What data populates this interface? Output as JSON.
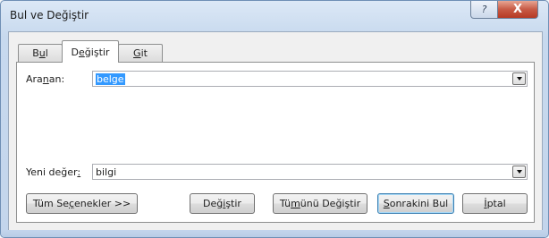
{
  "window": {
    "title": "Bul ve Değiştir"
  },
  "titlebar": {
    "help_label": "?",
    "close_label": "X"
  },
  "tabs": [
    {
      "pre": "B",
      "key": "u",
      "post": "l"
    },
    {
      "pre": "D",
      "key": "e",
      "post": "ğiştir"
    },
    {
      "pre": "",
      "key": "G",
      "post": "it"
    }
  ],
  "find": {
    "label_pre": "Ara",
    "label_key": "n",
    "label_post": "an:",
    "value": "belge"
  },
  "replace": {
    "label_pre": "Yeni değer",
    "label_key": ":",
    "label_post": "",
    "value": "bilgi"
  },
  "buttons": {
    "more": {
      "pre": "Tüm Se",
      "key": "ç",
      "post": "enekler >>"
    },
    "replace": {
      "pre": "Değ",
      "key": "i",
      "post": "ştir"
    },
    "replace_all": {
      "pre": "Tü",
      "key": "m",
      "post": "ünü Değiştir"
    },
    "find_next": {
      "pre": "",
      "key": "S",
      "post": "onrakini Bul"
    },
    "cancel": {
      "pre": "",
      "key": "İ",
      "post": "ptal"
    }
  }
}
